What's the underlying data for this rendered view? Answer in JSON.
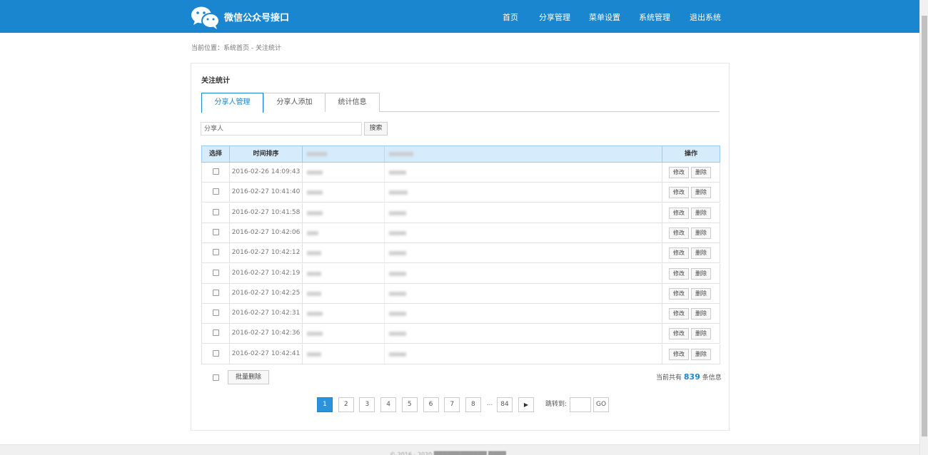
{
  "header": {
    "brand": "微信公众号接口",
    "nav": [
      "首页",
      "分享管理",
      "菜单设置",
      "系统管理",
      "退出系统"
    ],
    "color": "#1a86d0"
  },
  "breadcrumb": "当前位置：系统首页 - 关注统计",
  "card": {
    "title": "关注统计",
    "tabs": [
      "分享人管理",
      "分享人添加",
      "统计信息"
    ],
    "active_tab": 0
  },
  "search": {
    "placeholder": "分享人",
    "button": "搜索"
  },
  "table": {
    "headers": {
      "select": "选择",
      "time": "时间排序",
      "ops": "操作"
    },
    "rows": [
      {
        "time": "2016-02-26 14:09:43"
      },
      {
        "time": "2016-02-27 10:41:40"
      },
      {
        "time": "2016-02-27 10:41:58"
      },
      {
        "time": "2016-02-27 10:42:06"
      },
      {
        "time": "2016-02-27 10:42:12"
      },
      {
        "time": "2016-02-27 10:42:19"
      },
      {
        "time": "2016-02-27 10:42:25"
      },
      {
        "time": "2016-02-27 10:42:31"
      },
      {
        "time": "2016-02-27 10:42:36"
      },
      {
        "time": "2016-02-27 10:42:41"
      }
    ],
    "edit_label": "修改",
    "delete_label": "删除"
  },
  "bulk": {
    "delete_label": "批量删除"
  },
  "total": {
    "prefix": "当前共有",
    "count": "839",
    "suffix": "条信息"
  },
  "pagination": {
    "pages": [
      "1",
      "2",
      "3",
      "4",
      "5",
      "6",
      "7",
      "8"
    ],
    "ellipsis": "...",
    "last": "84",
    "next_icon": "▶",
    "jump_label": "跳转到:",
    "go_label": "GO",
    "current": "1"
  }
}
